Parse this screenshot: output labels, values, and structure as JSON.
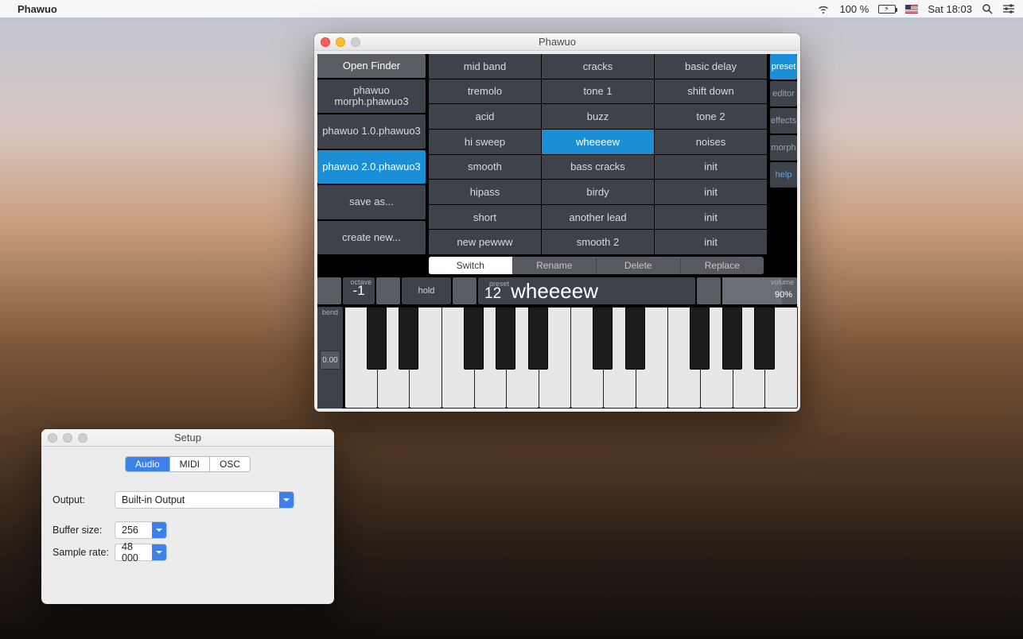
{
  "menubar": {
    "app_name": "Phawuo",
    "battery_pct": "100 %",
    "date_time": "Sat 18:03"
  },
  "main_window": {
    "title": "Phawuo",
    "sidebar": {
      "open_finder": "Open Finder",
      "files": [
        "phawuo morph.phawuo3",
        "phawuo 1.0.phawuo3",
        "phawuo 2.0.phawuo3"
      ],
      "selected_file": 2,
      "save_as": "save as...",
      "create_new": "create new..."
    },
    "right_tabs": [
      "preset",
      "editor",
      "effects",
      "morph",
      "help"
    ],
    "right_tab_selected": 0,
    "grid": [
      [
        "mid band",
        "cracks",
        "basic delay"
      ],
      [
        "tremolo",
        "tone 1",
        "shift down"
      ],
      [
        "acid",
        "buzz",
        "tone 2"
      ],
      [
        "hi sweep",
        "wheeeew",
        "noises"
      ],
      [
        "smooth",
        "bass cracks",
        "init"
      ],
      [
        "hipass",
        "birdy",
        "init"
      ],
      [
        "short",
        "another lead",
        "init"
      ],
      [
        "new pewww",
        "smooth 2",
        "init"
      ]
    ],
    "grid_selected": [
      3,
      1
    ],
    "actions": [
      "Switch",
      "Rename",
      "Delete",
      "Replace"
    ],
    "action_selected": 0,
    "controls": {
      "octave_label": "octave",
      "octave_value": "-1",
      "hold": "hold",
      "preset_label": "preset",
      "preset_number": "12",
      "preset_name": "wheeeew",
      "volume_label": "volume",
      "volume_value": "90%",
      "bend_label": "bend",
      "bend_value": "0.00"
    }
  },
  "setup_window": {
    "title": "Setup",
    "tabs": [
      "Audio",
      "MIDI",
      "OSC"
    ],
    "tab_selected": 0,
    "output_label": "Output:",
    "output_value": "Built-in Output",
    "buffer_label": "Buffer size:",
    "buffer_value": "256",
    "rate_label": "Sample rate:",
    "rate_value": "48 000"
  }
}
